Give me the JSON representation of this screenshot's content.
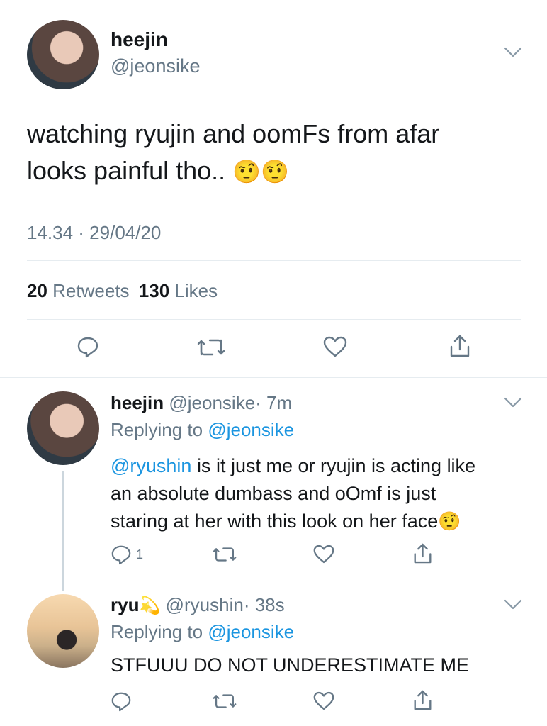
{
  "main_tweet": {
    "display_name": "heejin",
    "handle": "@jeonsike",
    "text_line1": "watching ryujin and oomFs from afar",
    "text_line2": "looks painful tho..",
    "emoji": "🤨🤨",
    "timestamp": "14.34 · 29/04/20",
    "retweets_count": "20",
    "retweets_label": "Retweets",
    "likes_count": "130",
    "likes_label": "Likes"
  },
  "reply1": {
    "display_name": "heejin",
    "handle": "@jeonsike",
    "time": "· 7m",
    "replying_to_label": "Replying to",
    "replying_to_handle": "@jeonsike",
    "mention": "@ryushin",
    "text_line1": " is it just me or ryujin is acting like",
    "text_line2": "an absolute dumbass and oOmf is just",
    "text_line3": "staring at her with this look on her face",
    "emoji": "🤨",
    "reply_count": "1"
  },
  "reply2": {
    "display_name": "ryu",
    "name_emoji": "💫",
    "handle": "@ryushin",
    "time": "· 38s",
    "replying_to_label": "Replying to",
    "replying_to_handle": "@jeonsike",
    "text": "STFUUU DO NOT UNDERESTIMATE ME"
  },
  "icons": {
    "reply": "reply-icon",
    "retweet": "retweet-icon",
    "like": "heart-icon",
    "share": "share-icon",
    "more": "chevron-down-icon"
  },
  "colors": {
    "text": "#14171a",
    "muted": "#657786",
    "link": "#1b95e0",
    "divider": "#e6ecf0"
  }
}
